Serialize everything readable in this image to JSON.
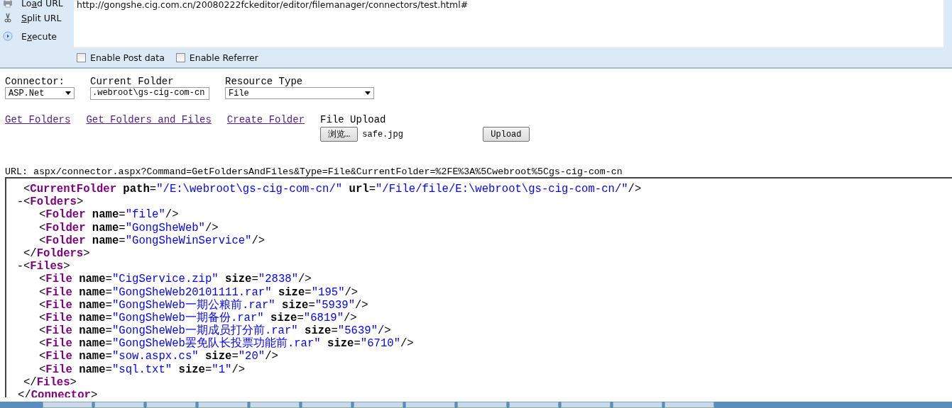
{
  "hackbar": {
    "actions": [
      {
        "kind": "load",
        "label": {
          "before": "Lo",
          "key": "a",
          "after": "d URL"
        }
      },
      {
        "kind": "split",
        "label": {
          "key": "S",
          "after": "plit URL"
        }
      },
      {
        "kind": "execute",
        "label": {
          "before": "E",
          "key": "x",
          "after": "ecute"
        }
      }
    ],
    "url": "http://gongshe.cig.com.cn/20080222fckeditor/editor/filemanager/connectors/test.html#",
    "options": [
      {
        "label": "Enable Post data",
        "checked": false
      },
      {
        "label": "Enable Referrer",
        "checked": false
      }
    ]
  },
  "form": {
    "connector": {
      "label": "Connector:",
      "value": "ASP.Net"
    },
    "current_folder": {
      "label": "Current Folder",
      "value": ".webroot\\gs-cig-com-cn"
    },
    "resource_type": {
      "label": "Resource Type",
      "value": "File"
    },
    "links": [
      "Get Folders",
      "Get Folders and Files",
      "Create Folder"
    ],
    "file_upload": {
      "label": "File Upload",
      "browse": "浏览…",
      "file": "safe.jpg",
      "upload": "Upload"
    }
  },
  "request_url": "URL: aspx/connector.aspx?Command=GetFoldersAndFiles&Type=File&CurrentFolder=%2FE%3A%5Cwebroot%5Cgs-cig-com-cn",
  "xml": {
    "nodes": [
      {
        "line": [
          "<",
          {
            "tag": "CurrentFolder"
          },
          {
            "attr": " path"
          },
          "=",
          {
            "value": "\"/E:\\webroot\\gs-cig-com-cn/\""
          },
          {
            "attr": " url"
          },
          "=",
          {
            "value": "\"/File/file/E:\\webroot\\gs-cig-com-cn/\""
          },
          "/>"
        ]
      },
      {
        "toggle": "-",
        "expanded": true,
        "line": [
          "<",
          {
            "tag": "Folders"
          },
          ">"
        ],
        "close": [
          "</",
          {
            "tag": "Folders"
          },
          ">"
        ],
        "children": [
          {
            "line": [
              "<",
              {
                "tag": "Folder"
              },
              {
                "attr": " name"
              },
              "=",
              {
                "value": "\"file\""
              },
              "/>"
            ]
          },
          {
            "line": [
              "<",
              {
                "tag": "Folder"
              },
              {
                "attr": " name"
              },
              "=",
              {
                "value": "\"GongSheWeb\""
              },
              "/>"
            ]
          },
          {
            "line": [
              "<",
              {
                "tag": "Folder"
              },
              {
                "attr": " name"
              },
              "=",
              {
                "value": "\"GongSheWinService\""
              },
              "/>"
            ]
          }
        ]
      },
      {
        "toggle": "-",
        "expanded": true,
        "line": [
          "<",
          {
            "tag": "Files"
          },
          ">"
        ],
        "close": [
          "</",
          {
            "tag": "Files"
          },
          ">"
        ],
        "children": [
          {
            "line": [
              "<",
              {
                "tag": "File"
              },
              {
                "attr": " name"
              },
              "=",
              {
                "value": "\"CigService.zip\""
              },
              {
                "attr": " size"
              },
              "=",
              {
                "value": "\"2838\""
              },
              "/>"
            ]
          },
          {
            "line": [
              "<",
              {
                "tag": "File"
              },
              {
                "attr": " name"
              },
              "=",
              {
                "value": "\"GongSheWeb20101111.rar\""
              },
              {
                "attr": " size"
              },
              "=",
              {
                "value": "\"195\""
              },
              "/>"
            ]
          },
          {
            "line": [
              "<",
              {
                "tag": "File"
              },
              {
                "attr": " name"
              },
              "=",
              {
                "value": "\"GongSheWeb一期公粮前.rar\""
              },
              {
                "attr": " size"
              },
              "=",
              {
                "value": "\"5939\""
              },
              "/>"
            ]
          },
          {
            "line": [
              "<",
              {
                "tag": "File"
              },
              {
                "attr": " name"
              },
              "=",
              {
                "value": "\"GongSheWeb一期备份.rar\""
              },
              {
                "attr": " size"
              },
              "=",
              {
                "value": "\"6819\""
              },
              "/>"
            ]
          },
          {
            "line": [
              "<",
              {
                "tag": "File"
              },
              {
                "attr": " name"
              },
              "=",
              {
                "value": "\"GongSheWeb一期成员打分前.rar\""
              },
              {
                "attr": " size"
              },
              "=",
              {
                "value": "\"5639\""
              },
              "/>"
            ]
          },
          {
            "line": [
              "<",
              {
                "tag": "File"
              },
              {
                "attr": " name"
              },
              "=",
              {
                "value": "\"GongSheWeb罢免队长投票功能前.rar\""
              },
              {
                "attr": " size"
              },
              "=",
              {
                "value": "\"6710\""
              },
              "/>"
            ]
          },
          {
            "line": [
              "<",
              {
                "tag": "File"
              },
              {
                "attr": " name"
              },
              "=",
              {
                "value": "\"sow.aspx.cs\""
              },
              {
                "attr": " size"
              },
              "=",
              {
                "value": "\"20\""
              },
              "/>"
            ]
          },
          {
            "line": [
              "<",
              {
                "tag": "File"
              },
              {
                "attr": " name"
              },
              "=",
              {
                "value": "\"sql.txt\""
              },
              {
                "attr": " size"
              },
              "=",
              {
                "value": "\"1\""
              },
              "/>"
            ]
          }
        ]
      }
    ],
    "closing": [
      "</",
      {
        "tag": "Connector"
      },
      ">"
    ]
  }
}
